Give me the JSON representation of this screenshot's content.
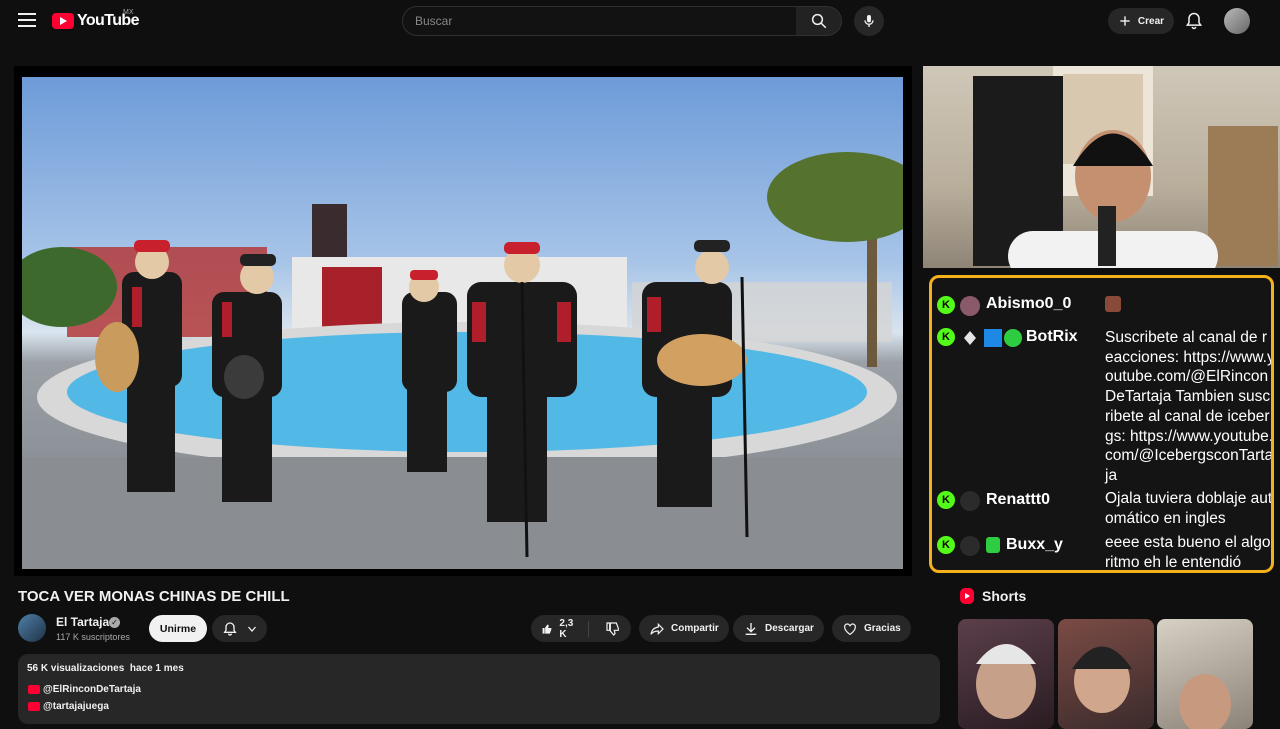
{
  "header": {
    "logo_text": "YouTube",
    "country_code": "MX",
    "search_placeholder": "Buscar",
    "create_label": "Crear"
  },
  "video": {
    "title": "TOCA VER MONAS CHINAS DE CHILL",
    "channel": {
      "name": "El Tartaja",
      "subscribers": "117 K suscriptores",
      "join_label": "Unirme"
    },
    "actions": {
      "likes": "2,3 K",
      "share_label": "Compartir",
      "download_label": "Descargar",
      "thanks_label": "Gracias"
    },
    "description": {
      "views": "56 K visualizaciones",
      "date": "hace 1 mes",
      "links": [
        "@ElRinconDeTartaja",
        "@tartajajuega"
      ]
    }
  },
  "chat": {
    "messages": [
      {
        "user": "Abismo0_0",
        "text": ""
      },
      {
        "user": "BotRix",
        "text": "Suscribete al canal de reacciones: https://www.youtube.com/@ElRinconDeTartaja Tambien suscribete al canal de icebergs: https://www.youtube.com/@IcebergsconTartaja"
      },
      {
        "user": "Renattt0",
        "text": "Ojala tuviera doblaje automático en ingles"
      },
      {
        "user": "Buxx_y",
        "text": "eeee esta bueno el algoritmo eh le entendió"
      }
    ],
    "badge_letter": "K"
  },
  "sidebar": {
    "shorts_label": "Shorts"
  },
  "colors": {
    "youtube_red": "#ff0033",
    "chat_border": "#f3b21c",
    "kick_green": "#53fc18",
    "background": "#0f0f0f"
  }
}
